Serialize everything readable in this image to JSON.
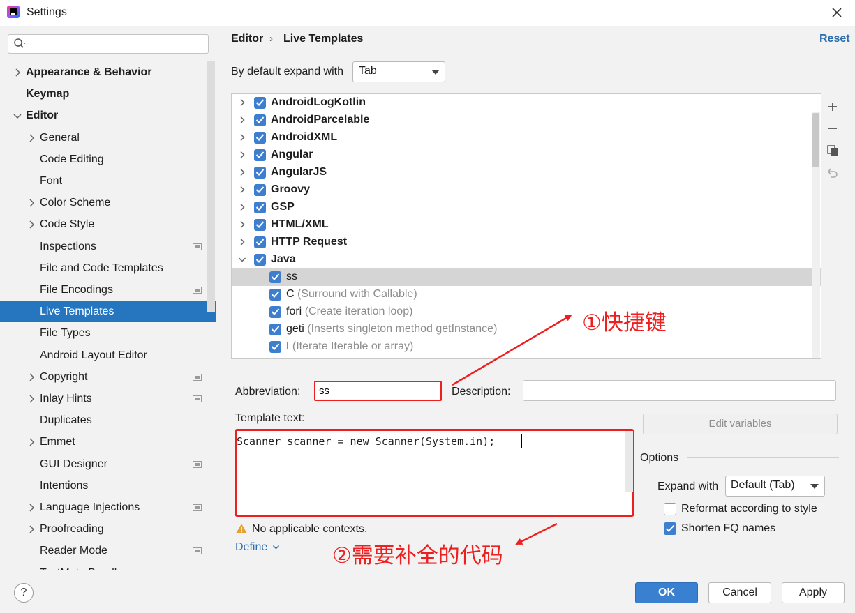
{
  "window": {
    "title": "Settings",
    "close_icon": "close-icon"
  },
  "search": {
    "placeholder": "",
    "icon": "search-icon"
  },
  "tree": [
    {
      "label": "Appearance & Behavior",
      "bold": true,
      "chevron": "right",
      "indent": 0,
      "project": false
    },
    {
      "label": "Keymap",
      "bold": true,
      "chevron": "",
      "indent": 0,
      "project": false
    },
    {
      "label": "Editor",
      "bold": true,
      "chevron": "down",
      "indent": 0,
      "project": false
    },
    {
      "label": "General",
      "bold": false,
      "chevron": "right",
      "indent": 1,
      "project": false
    },
    {
      "label": "Code Editing",
      "bold": false,
      "chevron": "",
      "indent": 1,
      "project": false
    },
    {
      "label": "Font",
      "bold": false,
      "chevron": "",
      "indent": 1,
      "project": false
    },
    {
      "label": "Color Scheme",
      "bold": false,
      "chevron": "right",
      "indent": 1,
      "project": false
    },
    {
      "label": "Code Style",
      "bold": false,
      "chevron": "right",
      "indent": 1,
      "project": false
    },
    {
      "label": "Inspections",
      "bold": false,
      "chevron": "",
      "indent": 1,
      "project": true
    },
    {
      "label": "File and Code Templates",
      "bold": false,
      "chevron": "",
      "indent": 1,
      "project": false
    },
    {
      "label": "File Encodings",
      "bold": false,
      "chevron": "",
      "indent": 1,
      "project": true
    },
    {
      "label": "Live Templates",
      "bold": false,
      "chevron": "",
      "indent": 1,
      "project": false,
      "selected": true
    },
    {
      "label": "File Types",
      "bold": false,
      "chevron": "",
      "indent": 1,
      "project": false
    },
    {
      "label": "Android Layout Editor",
      "bold": false,
      "chevron": "",
      "indent": 1,
      "project": false
    },
    {
      "label": "Copyright",
      "bold": false,
      "chevron": "right",
      "indent": 1,
      "project": true
    },
    {
      "label": "Inlay Hints",
      "bold": false,
      "chevron": "right",
      "indent": 1,
      "project": true
    },
    {
      "label": "Duplicates",
      "bold": false,
      "chevron": "",
      "indent": 1,
      "project": false
    },
    {
      "label": "Emmet",
      "bold": false,
      "chevron": "right",
      "indent": 1,
      "project": false
    },
    {
      "label": "GUI Designer",
      "bold": false,
      "chevron": "",
      "indent": 1,
      "project": true
    },
    {
      "label": "Intentions",
      "bold": false,
      "chevron": "",
      "indent": 1,
      "project": false
    },
    {
      "label": "Language Injections",
      "bold": false,
      "chevron": "right",
      "indent": 1,
      "project": true
    },
    {
      "label": "Proofreading",
      "bold": false,
      "chevron": "right",
      "indent": 1,
      "project": false
    },
    {
      "label": "Reader Mode",
      "bold": false,
      "chevron": "",
      "indent": 1,
      "project": true
    },
    {
      "label": "TextMate Bundles",
      "bold": false,
      "chevron": "",
      "indent": 1,
      "project": false
    }
  ],
  "header": {
    "breadcrumb_1": "Editor",
    "breadcrumb_sep": "›",
    "breadcrumb_2": "Live Templates",
    "reset": "Reset",
    "expand_label": "By default expand with",
    "expand_value": "Tab"
  },
  "templates": [
    {
      "name": "AndroidLogKotlin",
      "desc": "",
      "group": true,
      "chevron": "right"
    },
    {
      "name": "AndroidParcelable",
      "desc": "",
      "group": true,
      "chevron": "right"
    },
    {
      "name": "AndroidXML",
      "desc": "",
      "group": true,
      "chevron": "right"
    },
    {
      "name": "Angular",
      "desc": "",
      "group": true,
      "chevron": "right"
    },
    {
      "name": "AngularJS",
      "desc": "",
      "group": true,
      "chevron": "right"
    },
    {
      "name": "Groovy",
      "desc": "",
      "group": true,
      "chevron": "right"
    },
    {
      "name": "GSP",
      "desc": "",
      "group": true,
      "chevron": "right"
    },
    {
      "name": "HTML/XML",
      "desc": "",
      "group": true,
      "chevron": "right"
    },
    {
      "name": "HTTP Request",
      "desc": "",
      "group": true,
      "chevron": "right"
    },
    {
      "name": "Java",
      "desc": "",
      "group": true,
      "chevron": "down"
    },
    {
      "name": "ss",
      "desc": "",
      "group": false,
      "chevron": "",
      "selected": true
    },
    {
      "name": "C",
      "desc": "(Surround with Callable)",
      "group": false,
      "chevron": ""
    },
    {
      "name": "fori",
      "desc": "(Create iteration loop)",
      "group": false,
      "chevron": ""
    },
    {
      "name": "geti",
      "desc": "(Inserts singleton method getInstance)",
      "group": false,
      "chevron": ""
    },
    {
      "name": "I",
      "desc": "(Iterate Iterable or array)",
      "group": false,
      "chevron": ""
    }
  ],
  "toolbar": {
    "add": "+",
    "remove": "−",
    "copy_icon": "copy-icon",
    "restore_icon": "undo-icon"
  },
  "form": {
    "abbr_label": "Abbreviation:",
    "abbr_value": "ss",
    "desc_label": "Description:",
    "desc_value": "",
    "template_label": "Template text:",
    "template_code": "Scanner scanner = new Scanner(System.in);",
    "edit_variables": "Edit variables",
    "options_title": "Options",
    "expand_with_label": "Expand with",
    "expand_with_value": "Default (Tab)",
    "reformat_label": "Reformat according to style",
    "reformat_checked": false,
    "shorten_label": "Shorten FQ names",
    "shorten_checked": true,
    "warning_text": "No applicable contexts.",
    "define_link": "Define"
  },
  "annotations": {
    "shortcut_note": "①快捷键",
    "code_note": "②需要补全的代码",
    "color": "#ee1f1f"
  },
  "footer": {
    "help": "?",
    "ok": "OK",
    "cancel": "Cancel",
    "apply": "Apply"
  },
  "colors": {
    "accent": "#2675bf",
    "link": "#2c6db0",
    "checkbox": "#3d7ecf",
    "annotation": "#ee1f1f"
  }
}
